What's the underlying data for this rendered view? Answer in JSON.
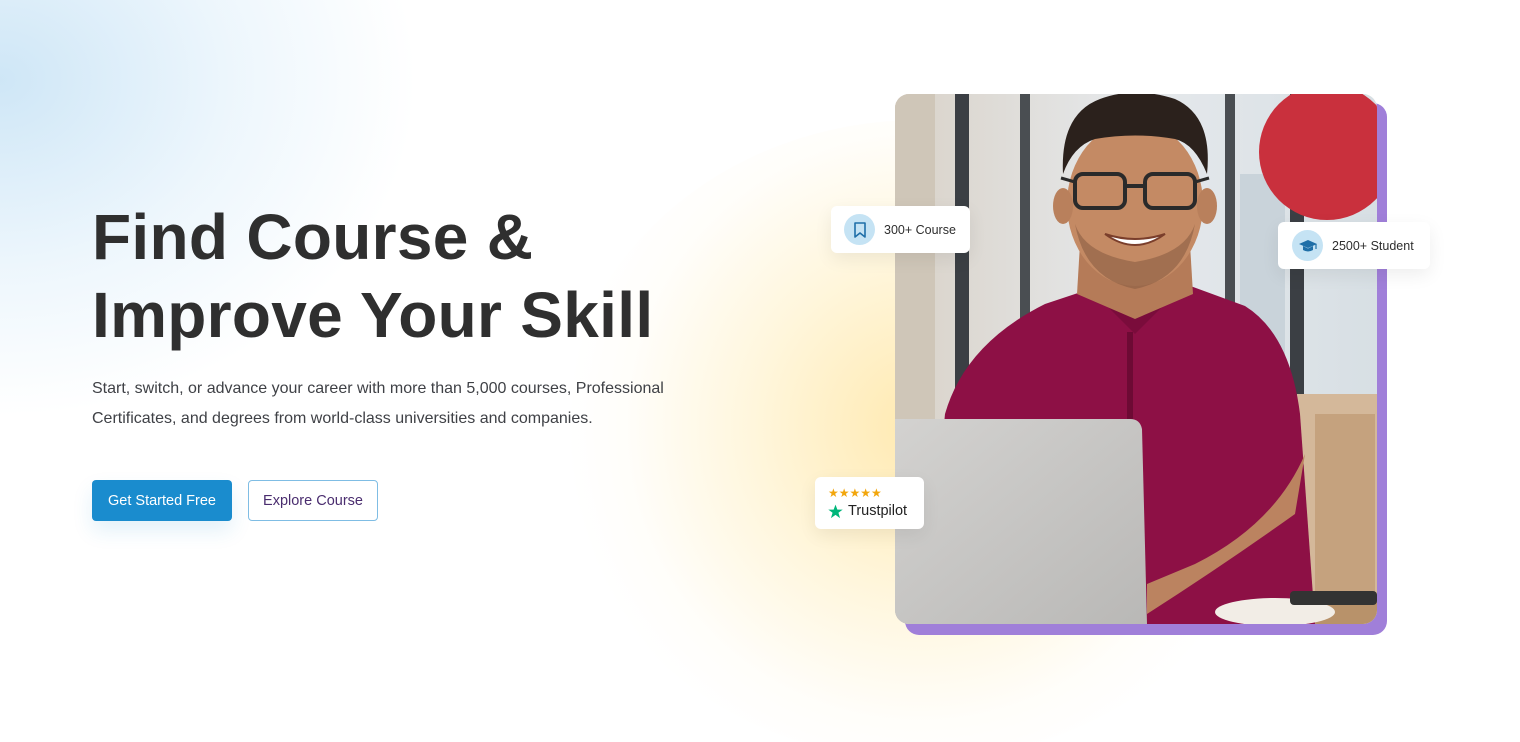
{
  "hero": {
    "heading_line1": "Find Course &",
    "heading_line2": "Improve Your Skill",
    "subtitle": "Start, switch, or advance your career with more than 5,000 courses, Professional Certificates, and degrees from world-class universities and companies.",
    "primary_button": "Get Started Free",
    "secondary_button": "Explore Course"
  },
  "badges": {
    "courses": {
      "label": "300+ Course",
      "icon": "bookmark-icon"
    },
    "students": {
      "label": "2500+ Student",
      "icon": "graduation-cap-icon"
    },
    "trustpilot": {
      "label": "Trustpilot",
      "stars": "★★★★★",
      "rating": 5,
      "icon": "trustpilot-star-icon"
    }
  },
  "colors": {
    "primary": "#1a8cce",
    "heading": "#2f2f2f",
    "photo_frame": "#a07fd9",
    "star": "#f2a60c",
    "trustpilot_green": "#00b67a"
  }
}
